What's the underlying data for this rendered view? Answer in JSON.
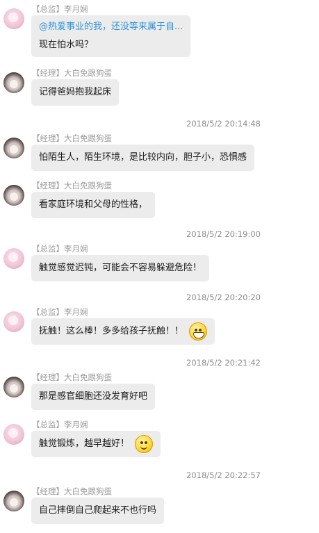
{
  "chat": {
    "messages": [
      {
        "sender": "【总监】李月娴",
        "quote": "@热爱事业的我，还没等来属于自...",
        "text": "现在怕水吗？"
      },
      {
        "sender": "【经理】大白免跟狗蛋",
        "text": "记得爸妈抱我起床"
      },
      {
        "sender": "【经理】大白免跟狗蛋",
        "text": "怕陌生人，陌生环境，是比较内向，胆子小，恐惧感"
      },
      {
        "sender": "【经理】大白免跟狗蛋",
        "text": "看家庭环境和父母的性格，"
      },
      {
        "sender": "【总监】李月娴",
        "text": "触觉感觉迟钝，可能会不容易躲避危险！"
      },
      {
        "sender": "【总监】李月娴",
        "text": "抚触！这么棒！多多给孩子抚触！！",
        "emoji": "grin-emoji"
      },
      {
        "sender": "【经理】大白免跟狗蛋",
        "text": "那是感官细胞还没发育好吧"
      },
      {
        "sender": "【总监】李月娴",
        "text": "触觉锻炼，越早越好！",
        "emoji": "smile-emoji"
      },
      {
        "sender": "【经理】大白免跟狗蛋",
        "text": "自己摔倒自己爬起来不也行吗"
      }
    ],
    "timestamps": [
      "2018/5/2 20:14:48",
      "2018/5/2 20:19:00",
      "2018/5/2 20:20:20",
      "2018/5/2 20:21:42",
      "2018/5/2 20:22:57"
    ]
  }
}
